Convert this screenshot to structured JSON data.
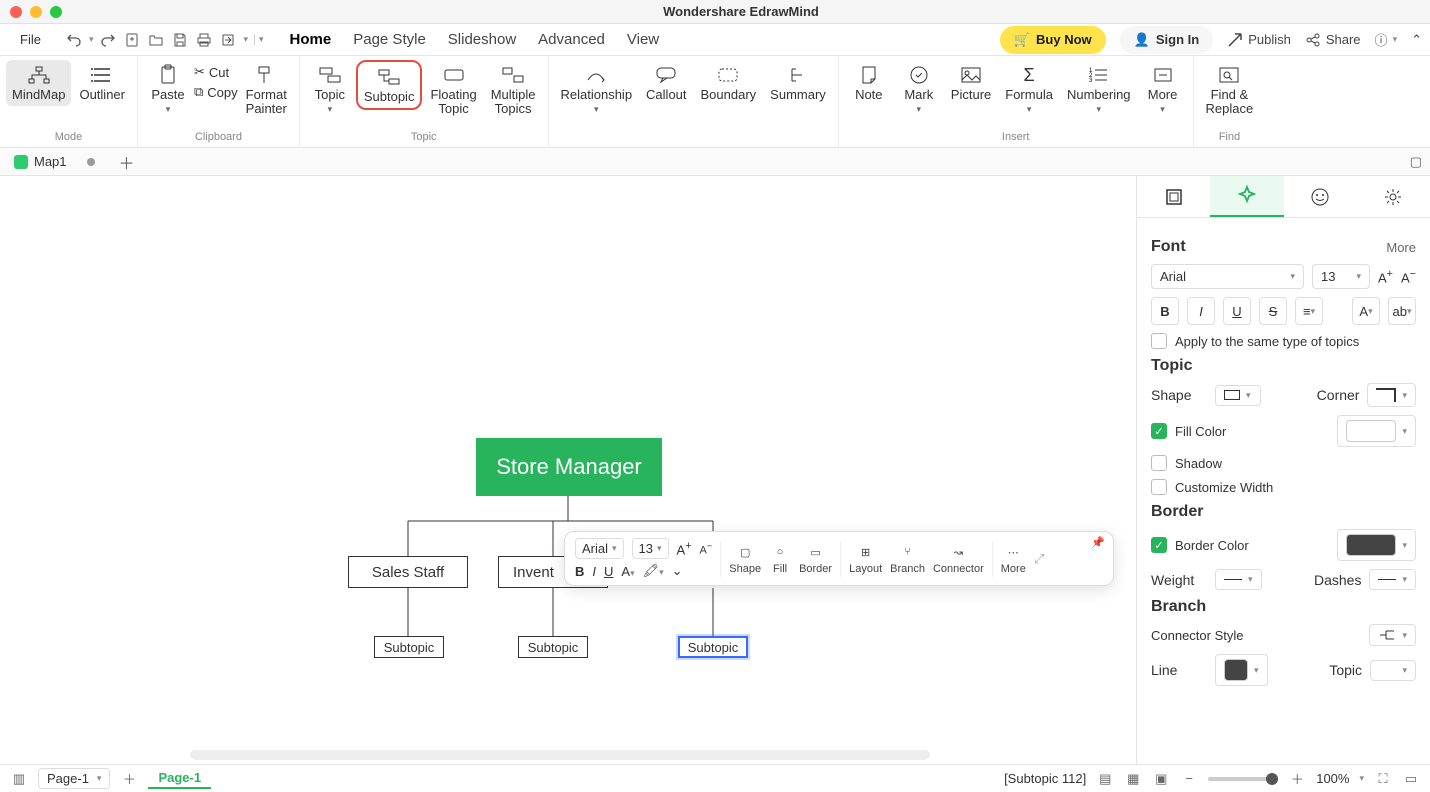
{
  "app": {
    "title": "Wondershare EdrawMind"
  },
  "menu": {
    "file": "File",
    "tabs": [
      "Home",
      "Page Style",
      "Slideshow",
      "Advanced",
      "View"
    ],
    "active_tab": 0,
    "buy_now": "Buy Now",
    "sign_in": "Sign In",
    "publish": "Publish",
    "share": "Share"
  },
  "ribbon": {
    "mode": {
      "mindmap": "MindMap",
      "outliner": "Outliner",
      "label": "Mode"
    },
    "clipboard": {
      "paste": "Paste",
      "cut": "Cut",
      "copy": "Copy",
      "format_painter": "Format\nPainter",
      "label": "Clipboard"
    },
    "topic": {
      "topic": "Topic",
      "subtopic": "Subtopic",
      "floating": "Floating\nTopic",
      "multiple": "Multiple\nTopics",
      "label": "Topic"
    },
    "link": {
      "relationship": "Relationship",
      "callout": "Callout",
      "boundary": "Boundary",
      "summary": "Summary"
    },
    "insert": {
      "note": "Note",
      "mark": "Mark",
      "picture": "Picture",
      "formula": "Formula",
      "numbering": "Numbering",
      "more": "More",
      "label": "Insert"
    },
    "find": {
      "findreplace": "Find &\nReplace",
      "label": "Find"
    }
  },
  "doctabs": {
    "map1": "Map1"
  },
  "mindmap": {
    "root": "Store Manager",
    "child1": "Sales Staff",
    "child2": "Invent",
    "leaf1": "Subtopic",
    "leaf2": "Subtopic",
    "leaf3": "Subtopic"
  },
  "float_toolbar": {
    "font": "Arial",
    "size": "13",
    "shape": "Shape",
    "fill": "Fill",
    "border": "Border",
    "layout": "Layout",
    "branch": "Branch",
    "connector": "Connector",
    "more": "More"
  },
  "right_panel": {
    "font": {
      "title": "Font",
      "more": "More",
      "family": "Arial",
      "size": "13",
      "apply_same": "Apply to the same type of topics"
    },
    "topic": {
      "title": "Topic",
      "shape": "Shape",
      "corner": "Corner",
      "fill_color": "Fill Color",
      "shadow": "Shadow",
      "custom_width": "Customize Width"
    },
    "border": {
      "title": "Border",
      "border_color": "Border Color",
      "weight": "Weight",
      "dashes": "Dashes"
    },
    "branch": {
      "title": "Branch",
      "connector_style": "Connector Style",
      "line": "Line",
      "topic": "Topic"
    }
  },
  "statusbar": {
    "page_select": "Page-1",
    "page_tab": "Page-1",
    "hint": "[Subtopic 112]",
    "zoom": "100%"
  }
}
